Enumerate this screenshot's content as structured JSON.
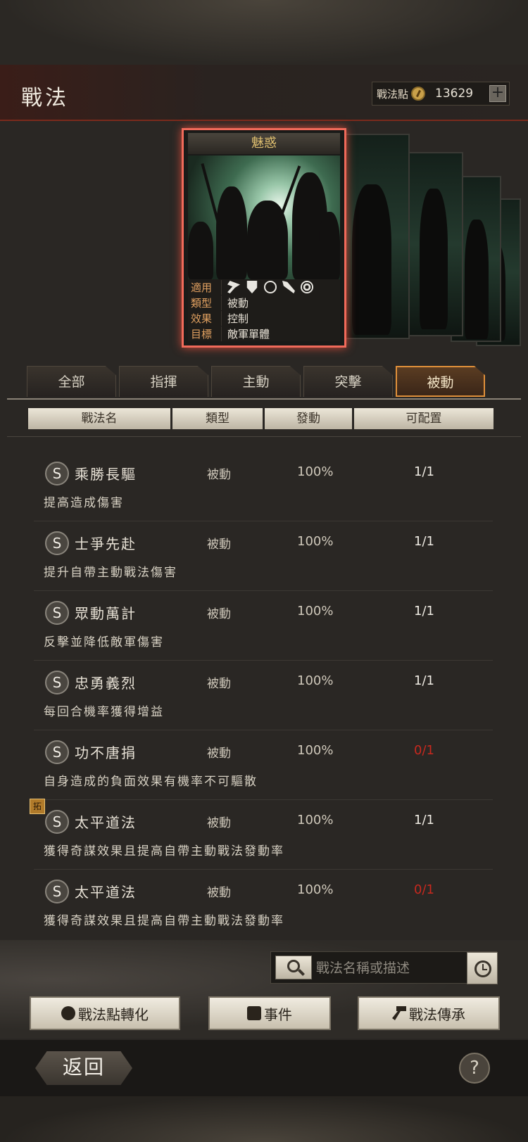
{
  "header": {
    "title": "戰法",
    "points_label": "戰法點",
    "points_value": "13629",
    "plus_label": "+"
  },
  "card": {
    "name": "魅惑",
    "rows": [
      {
        "key": "適用",
        "value": ""
      },
      {
        "key": "類型",
        "value": "被動"
      },
      {
        "key": "效果",
        "value": "控制"
      },
      {
        "key": "目標",
        "value": "敵軍單體"
      }
    ],
    "unit_icons": [
      "cavalry-icon",
      "shield-icon",
      "bow-icon",
      "spear-icon",
      "chariot-icon"
    ]
  },
  "tabs": [
    {
      "label": "全部",
      "active": false
    },
    {
      "label": "指揮",
      "active": false
    },
    {
      "label": "主動",
      "active": false
    },
    {
      "label": "突擊",
      "active": false
    },
    {
      "label": "被動",
      "active": true
    }
  ],
  "columns": [
    "戰法名",
    "類型",
    "發動",
    "可配置"
  ],
  "tactics": [
    {
      "grade": "S",
      "name": "乘勝長驅",
      "type": "被動",
      "rate": "100%",
      "count": "1/1",
      "available": true,
      "desc": "提高造成傷害",
      "badge": ""
    },
    {
      "grade": "S",
      "name": "士爭先赴",
      "type": "被動",
      "rate": "100%",
      "count": "1/1",
      "available": true,
      "desc": "提升自帶主動戰法傷害",
      "badge": ""
    },
    {
      "grade": "S",
      "name": "眾動萬計",
      "type": "被動",
      "rate": "100%",
      "count": "1/1",
      "available": true,
      "desc": "反擊並降低敵軍傷害",
      "badge": ""
    },
    {
      "grade": "S",
      "name": "忠勇義烈",
      "type": "被動",
      "rate": "100%",
      "count": "1/1",
      "available": true,
      "desc": "每回合機率獲得增益",
      "badge": ""
    },
    {
      "grade": "S",
      "name": "功不唐捐",
      "type": "被動",
      "rate": "100%",
      "count": "0/1",
      "available": false,
      "desc": "自身造成的負面效果有機率不可驅散",
      "badge": ""
    },
    {
      "grade": "S",
      "name": "太平道法",
      "type": "被動",
      "rate": "100%",
      "count": "1/1",
      "available": true,
      "desc": "獲得奇謀效果且提高自帶主動戰法發動率",
      "badge": "拓"
    },
    {
      "grade": "S",
      "name": "太平道法",
      "type": "被動",
      "rate": "100%",
      "count": "0/1",
      "available": false,
      "desc": "獲得奇謀效果且提高自帶主動戰法發動率",
      "badge": ""
    }
  ],
  "search": {
    "placeholder": "戰法名稱或描述"
  },
  "actions": {
    "convert_label": "戰法點轉化",
    "event_label": "事件",
    "inherit_label": "戰法傳承"
  },
  "footer": {
    "back_label": "返回",
    "help_label": "?"
  },
  "colors": {
    "accent_red": "#c8281e",
    "card_border": "#f06a5a",
    "tab_active": "#e0903a"
  }
}
